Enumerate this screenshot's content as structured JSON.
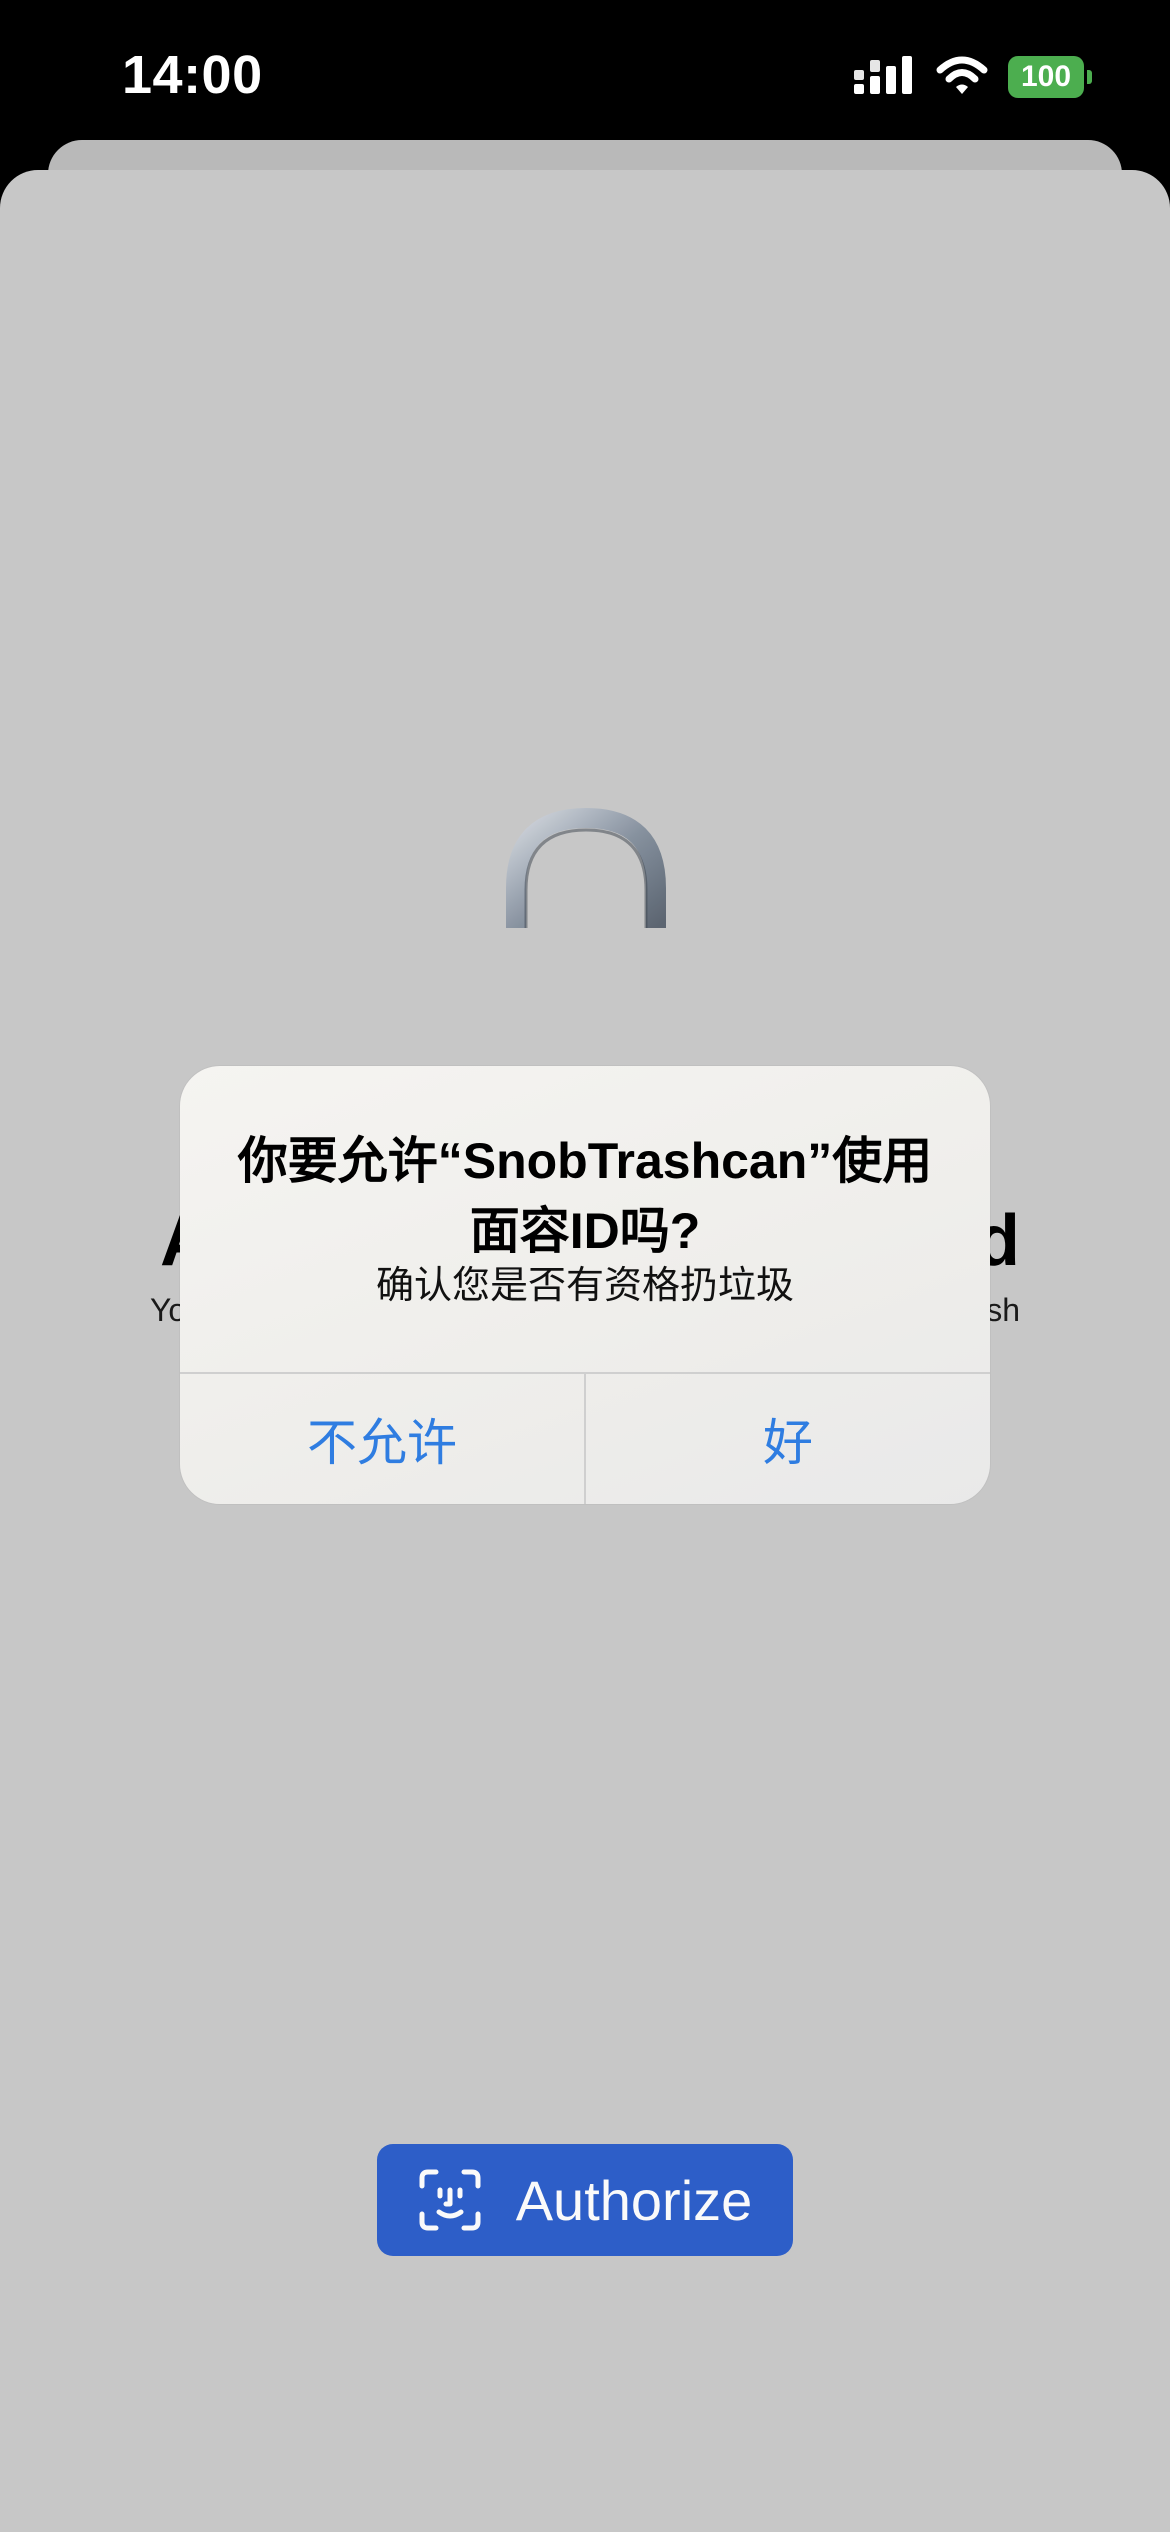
{
  "status_bar": {
    "time": "14:00",
    "battery_level": "100",
    "icons": [
      "signal-icon",
      "wifi-icon",
      "battery-icon"
    ],
    "battery_color": "#4cae4f"
  },
  "background": {
    "heading_left": "A",
    "heading_right": "d",
    "subtext_left": "Yo",
    "subtext_right": "sh"
  },
  "authorize_button": {
    "label": "Authorize",
    "icon": "face-id-icon",
    "color": "#2e60cc"
  },
  "alert": {
    "title": "你要允许“SnobTrashcan”使用面容ID吗?",
    "message": "确认您是否有资格扔垃圾",
    "buttons": {
      "deny": "不允许",
      "allow": "好"
    },
    "button_color": "#2f7de1"
  }
}
